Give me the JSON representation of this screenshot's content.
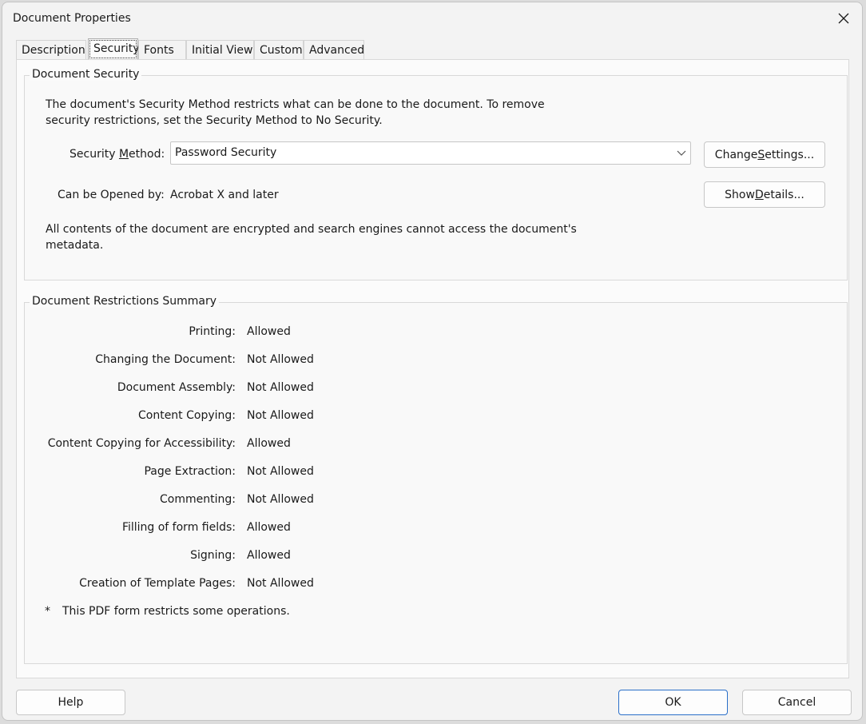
{
  "window": {
    "title": "Document Properties"
  },
  "tabs": [
    {
      "label": "Description",
      "active": false
    },
    {
      "label": "Security",
      "active": true
    },
    {
      "label": "Fonts",
      "active": false
    },
    {
      "label": "Initial View",
      "active": false
    },
    {
      "label": "Custom",
      "active": false
    },
    {
      "label": "Advanced",
      "active": false
    }
  ],
  "document_security": {
    "legend": "Document Security",
    "description_line1": "The document's Security Method restricts what can be done to the document. To remove",
    "description_line2": "security restrictions, set the Security Method to No Security.",
    "method_label_pre": "Security ",
    "method_label_ul": "M",
    "method_label_post": "ethod:",
    "method_value": "Password Security",
    "change_settings_pre": "Change ",
    "change_settings_ul": "S",
    "change_settings_post": "ettings...",
    "opened_by_label": "Can be Opened by:",
    "opened_by_value": "Acrobat X and later",
    "show_details_pre": "Show ",
    "show_details_ul": "D",
    "show_details_post": "etails...",
    "encryption_line1": "All contents of the document are encrypted and search engines cannot access the document's",
    "encryption_line2": "metadata."
  },
  "restrictions": {
    "legend": "Document Restrictions Summary",
    "items": [
      {
        "label": "Printing:",
        "value": "Allowed"
      },
      {
        "label": "Changing the Document:",
        "value": "Not Allowed"
      },
      {
        "label": "Document Assembly:",
        "value": "Not Allowed"
      },
      {
        "label": "Content Copying:",
        "value": "Not Allowed"
      },
      {
        "label": "Content Copying for Accessibility:",
        "value": "Allowed"
      },
      {
        "label": "Page Extraction:",
        "value": "Not Allowed"
      },
      {
        "label": "Commenting:",
        "value": "Not Allowed"
      },
      {
        "label": "Filling of form fields:",
        "value": "Allowed"
      },
      {
        "label": "Signing:",
        "value": "Allowed"
      },
      {
        "label": "Creation of Template Pages:",
        "value": "Not Allowed"
      }
    ],
    "footnote_marker": "*",
    "footnote_text": "This PDF form restricts some operations."
  },
  "buttons": {
    "help": "Help",
    "ok": "OK",
    "cancel": "Cancel"
  },
  "colors": {
    "ok_border": "#2a6fc9"
  },
  "icons": {
    "close": "close-icon",
    "dropdown": "chevron-down-icon"
  }
}
